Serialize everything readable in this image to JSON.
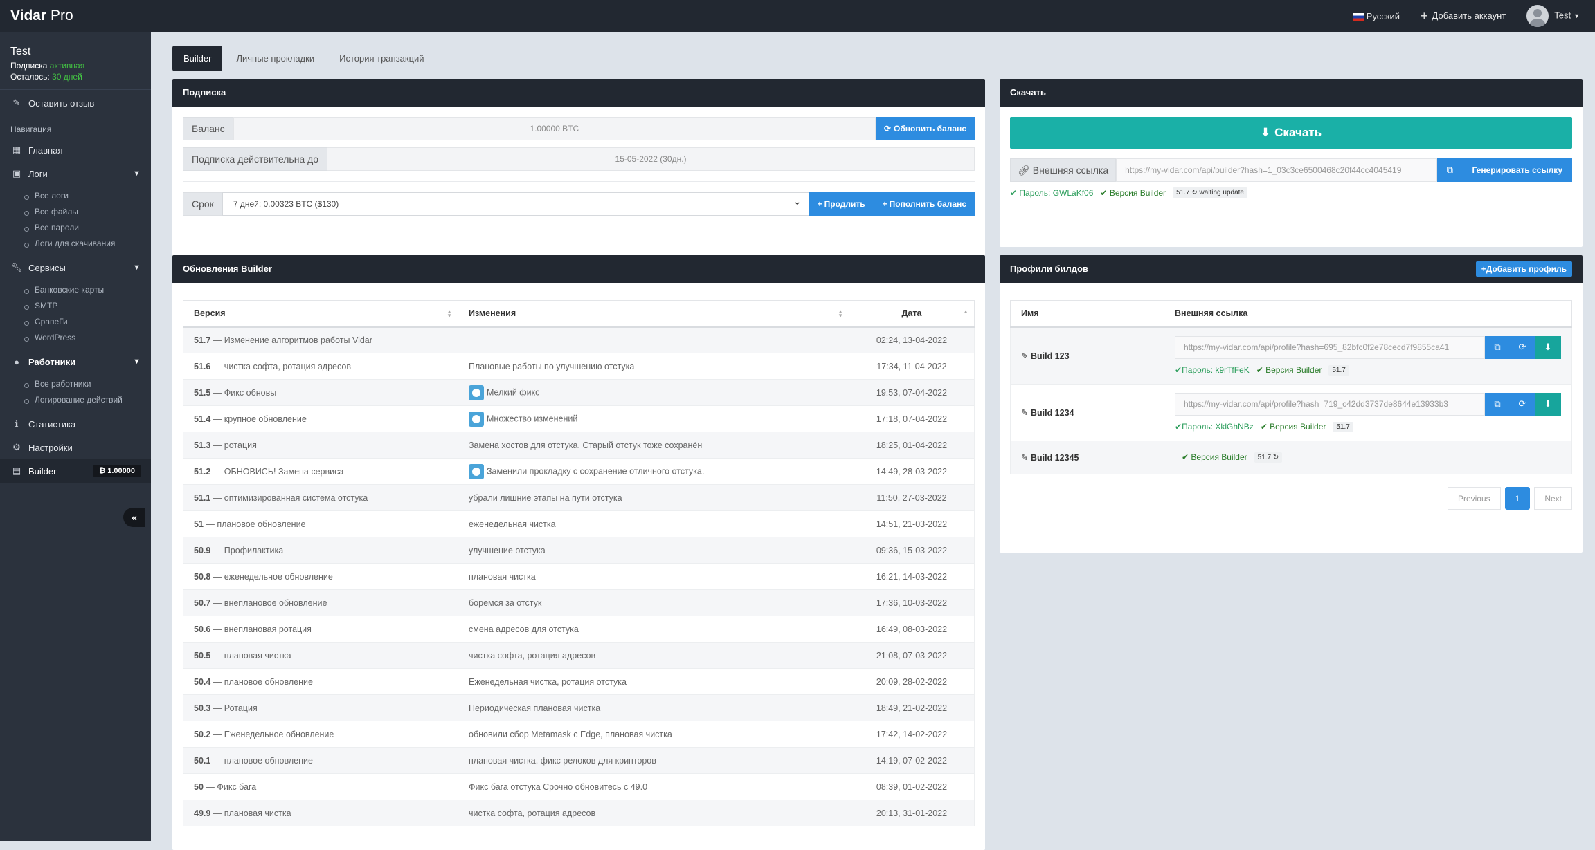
{
  "app": {
    "brand_bold": "Vidar",
    "brand_rest": " Pro"
  },
  "topbar": {
    "language": "Русский",
    "add_account": "Добавить аккаунт",
    "user": "Test"
  },
  "user": {
    "name": "Test",
    "sub_label": "Подписка ",
    "sub_status": "активная",
    "left_label": "Осталось: ",
    "left_value": "30 дней"
  },
  "menu": {
    "feedback": "Оставить отзыв",
    "nav_head": "Навигация",
    "home": "Главная",
    "logs": "Логи",
    "logs_items": [
      "Все логи",
      "Все файлы",
      "Все пароли",
      "Логи для скачивания"
    ],
    "services": "Сервисы",
    "services_items": [
      "Банковские карты",
      "SMTP",
      "СрапеГи",
      "WordPress"
    ],
    "workers": "Работники",
    "workers_items": [
      "Все работники",
      "Логирование действий"
    ],
    "stats": "Статистика",
    "settings": "Настройки",
    "builder": "Builder",
    "builder_badge": "₿ 1.00000"
  },
  "tabs": [
    "Builder",
    "Личные прокладки",
    "История транзакций"
  ],
  "subscription": {
    "title": "Подписка",
    "balance_label": "Баланс",
    "balance_value": "1.00000 BTC",
    "refresh": "Обновить баланс",
    "valid_label": "Подписка действительна до",
    "valid_value": "15-05-2022 (30дн.)",
    "term_label": "Срок",
    "term_value": "7 дней: 0.00323 BTC ($130)",
    "extend": "Продлить",
    "topup": "Пополнить баланс"
  },
  "download": {
    "title": "Скачать",
    "button": "Скачать",
    "link_label": "Внешняя ссылка",
    "link_value": "https://my-vidar.com/api/builder?hash=1_03c3ce6500468c20f44cc4045419",
    "generate": "Генерировать ссылку",
    "password": "Пароль: GWLaKf06",
    "version_label": "Версия Builder",
    "version": "51.7",
    "waiting": "waiting update"
  },
  "updates": {
    "title": "Обновления Builder",
    "columns": [
      "Версия",
      "Изменения",
      "Дата"
    ],
    "rows": [
      {
        "v": "51.7",
        "d": "— Изменение алгоритмов работы Vidar",
        "c": "",
        "info": false,
        "t": "02:24, 13-04-2022"
      },
      {
        "v": "51.6",
        "d": "— чистка софта, ротация адресов",
        "c": "Плановые работы по улучшению отстука",
        "info": false,
        "t": "17:34, 11-04-2022"
      },
      {
        "v": "51.5",
        "d": "— Фикс обновы",
        "c": "Мелкий фикс",
        "info": true,
        "t": "19:53, 07-04-2022"
      },
      {
        "v": "51.4",
        "d": "— крупное обновление",
        "c": "Множество изменений",
        "info": true,
        "t": "17:18, 07-04-2022"
      },
      {
        "v": "51.3",
        "d": "— ротация",
        "c": "Замена хостов для отстука. Старый отстук тоже сохранён",
        "info": false,
        "t": "18:25, 01-04-2022"
      },
      {
        "v": "51.2",
        "d": "— ОБНОВИСЬ! Замена сервиса",
        "c": "Заменили прокладку с сохранение отличного отстука.",
        "info": true,
        "t": "14:49, 28-03-2022"
      },
      {
        "v": "51.1",
        "d": "— оптимизированная система отстука",
        "c": "убрали лишние этапы на пути отстука",
        "info": false,
        "t": "11:50, 27-03-2022"
      },
      {
        "v": "51",
        "d": "— плановое обновление",
        "c": "еженедельная чистка",
        "info": false,
        "t": "14:51, 21-03-2022"
      },
      {
        "v": "50.9",
        "d": "— Профилактика",
        "c": "улучшение отстука",
        "info": false,
        "t": "09:36, 15-03-2022"
      },
      {
        "v": "50.8",
        "d": "— еженедельное обновление",
        "c": "плановая чистка",
        "info": false,
        "t": "16:21, 14-03-2022"
      },
      {
        "v": "50.7",
        "d": "— внеплановое обновление",
        "c": "боремся за отстук",
        "info": false,
        "t": "17:36, 10-03-2022"
      },
      {
        "v": "50.6",
        "d": "— внеплановая ротация",
        "c": "смена адресов для отстука",
        "info": false,
        "t": "16:49, 08-03-2022"
      },
      {
        "v": "50.5",
        "d": "— плановая чистка",
        "c": "чистка софта, ротация адресов",
        "info": false,
        "t": "21:08, 07-03-2022"
      },
      {
        "v": "50.4",
        "d": "— плановое обновление",
        "c": "Еженедельная чистка, ротация отстука",
        "info": false,
        "t": "20:09, 28-02-2022"
      },
      {
        "v": "50.3",
        "d": "— Ротация",
        "c": "Периодическая плановая чистка",
        "info": false,
        "t": "18:49, 21-02-2022"
      },
      {
        "v": "50.2",
        "d": "— Еженедельное обновление",
        "c": "обновили сбор Metamask с Edge, плановая чистка",
        "info": false,
        "t": "17:42, 14-02-2022"
      },
      {
        "v": "50.1",
        "d": "— плановое обновление",
        "c": "плановая чистка, фикс релоков для крипторов",
        "info": false,
        "t": "14:19, 07-02-2022"
      },
      {
        "v": "50",
        "d": "— Фикс бага",
        "c": "Фикс бага отстука Срочно обновитесь с 49.0",
        "info": false,
        "t": "08:39, 01-02-2022"
      },
      {
        "v": "49.9",
        "d": "— плановая чистка",
        "c": "чистка софта, ротация адресов",
        "info": false,
        "t": "20:13, 31-01-2022"
      }
    ]
  },
  "profiles": {
    "title": "Профили билдов",
    "add": "Добавить профиль",
    "columns": [
      "Имя",
      "Внешняя ссылка"
    ],
    "rows": [
      {
        "name": "Build 123",
        "link": "https://my-vidar.com/api/profile?hash=695_82bfc0f2e78cecd7f9855ca41",
        "password": "Пароль: k9rTfFeK",
        "version_label": "Версия Builder",
        "version": "51.7",
        "has_link": true
      },
      {
        "name": "Build 1234",
        "link": "https://my-vidar.com/api/profile?hash=719_c42dd3737de8644e13933b3",
        "password": "Пароль: XklGhNBz",
        "version_label": "Версия Builder",
        "version": "51.7",
        "has_link": true
      },
      {
        "name": "Build 12345",
        "link": "",
        "password": "",
        "version_label": "Версия Builder",
        "version": "51.7",
        "has_link": false
      }
    ],
    "pager": {
      "prev": "Previous",
      "page": "1",
      "next": "Next"
    }
  }
}
